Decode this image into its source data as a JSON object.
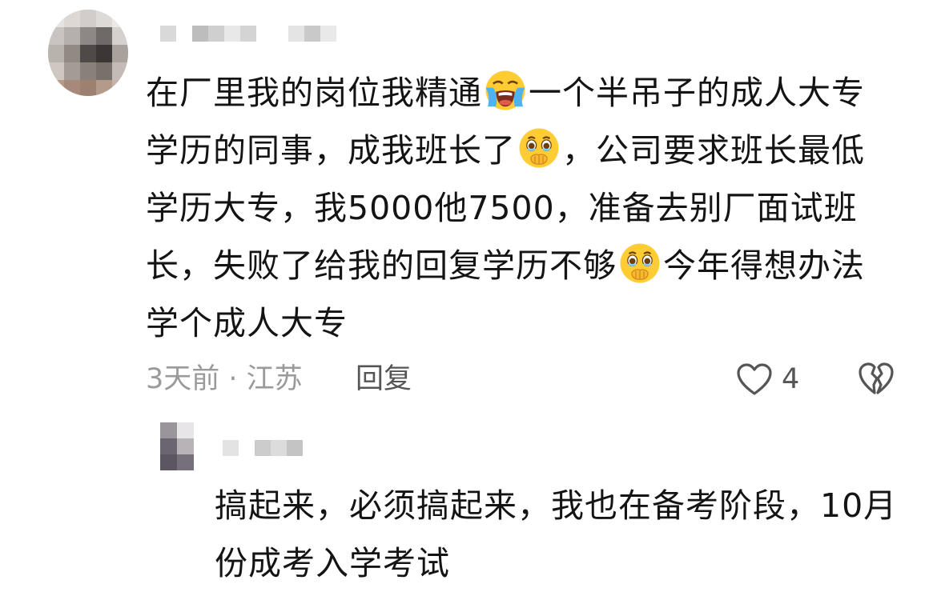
{
  "comment": {
    "avatar_icon": "pixelated-avatar-icon",
    "text_part1": "在厂里我的岗位我精通",
    "emoji1": "loudly-crying-face-icon",
    "text_part2": "一个半吊子的成人大专学历的同事，成我班长了",
    "emoji2": "holding-back-tears-icon",
    "text_part3": "，公司要求班长最低学历大专，我5000他7500，准备去别厂面试班长，失败了给我的回复学历不够",
    "emoji3": "holding-back-tears-icon",
    "text_part4": "今年得想办法学个成人大专",
    "meta": "3天前 · 江苏",
    "reply_label": "回复",
    "like_icon": "heart-outline-icon",
    "like_count": "4",
    "dislike_icon": "broken-heart-icon"
  },
  "reply": {
    "avatar_icon": "pixelated-avatar-icon",
    "text": "搞起来，必须搞起来，我也在备考阶段，10月份成考入学考试"
  },
  "colors": {
    "text": "#141414",
    "meta": "#9a9a9a",
    "action": "#555555",
    "emoji_face": "#ffcc33"
  }
}
